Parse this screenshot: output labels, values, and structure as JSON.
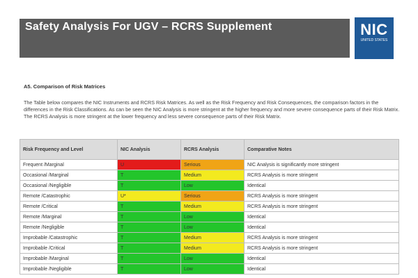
{
  "header": {
    "title": "Safety Analysis For UGV – RCRS Supplement",
    "bar_color": "#5b5b5b"
  },
  "logo": {
    "main": "NIC",
    "sub": "UNITED STATES"
  },
  "section": {
    "heading": "A5. Comparison of Risk Matrices",
    "paragraph": "The Table below compares the NIC Instruments and RCRS Risk Matrices. As well as the Risk Frequency and Risk Consequences, the comparison factors in the differences in the Risk Classifications. As can be seen the NIC Analysis is more stringent at the higher frequency and more severe consequence parts of their Risk Matrix. The RCRS Analysis is more stringent at the lower frequency and less severe consequence parts of their Risk Matrix."
  },
  "table": {
    "headers": [
      "Risk Frequency and Level",
      "NIC Analysis",
      "RCRS Analysis",
      "Comparative Notes"
    ],
    "colors": {
      "red": "#e31b1b",
      "orange": "#f0a416",
      "yellow": "#f3ea1f",
      "green": "#23c52b"
    },
    "rows": [
      {
        "rf": "Frequent /Marginal",
        "nic": "U",
        "nic_color": "red",
        "rcrs": "Serious",
        "rcrs_color": "orange",
        "note": "NIC Analysis is significantly more stringent"
      },
      {
        "rf": "Occasional /Marginal",
        "nic": "T",
        "nic_color": "green",
        "rcrs": "Medium",
        "rcrs_color": "yellow",
        "note": "RCRS Analysis is more stringent"
      },
      {
        "rf": "Occasional /Negligible",
        "nic": "T",
        "nic_color": "green",
        "rcrs": "Low",
        "rcrs_color": "green",
        "note": "Identical"
      },
      {
        "rf": "Remote /Catastrophic",
        "nic": "U*",
        "nic_color": "yellow",
        "rcrs": "Serious",
        "rcrs_color": "orange",
        "note": "RCRS Analysis is more stringent"
      },
      {
        "rf": "Remote /Critical",
        "nic": "T",
        "nic_color": "green",
        "rcrs": "Medium",
        "rcrs_color": "yellow",
        "note": "RCRS Analysis is more stringent"
      },
      {
        "rf": "Remote /Marginal",
        "nic": "T",
        "nic_color": "green",
        "rcrs": "Low",
        "rcrs_color": "green",
        "note": "Identical"
      },
      {
        "rf": "Remote /Negligible",
        "nic": "T",
        "nic_color": "green",
        "rcrs": "Low",
        "rcrs_color": "green",
        "note": "Identical"
      },
      {
        "rf": "Improbable /Catastrophic",
        "nic": "T",
        "nic_color": "green",
        "rcrs": "Medium",
        "rcrs_color": "yellow",
        "note": "RCRS Analysis is more stringent"
      },
      {
        "rf": "Improbable /Critical",
        "nic": "T",
        "nic_color": "green",
        "rcrs": "Medium",
        "rcrs_color": "yellow",
        "note": "RCRS Analysis is more stringent"
      },
      {
        "rf": "Improbable /Marginal",
        "nic": "T",
        "nic_color": "green",
        "rcrs": "Low",
        "rcrs_color": "green",
        "note": "Identical"
      },
      {
        "rf": "Improbable /Negligible",
        "nic": "T",
        "nic_color": "green",
        "rcrs": "Low",
        "rcrs_color": "green",
        "note": "Identical"
      }
    ]
  }
}
